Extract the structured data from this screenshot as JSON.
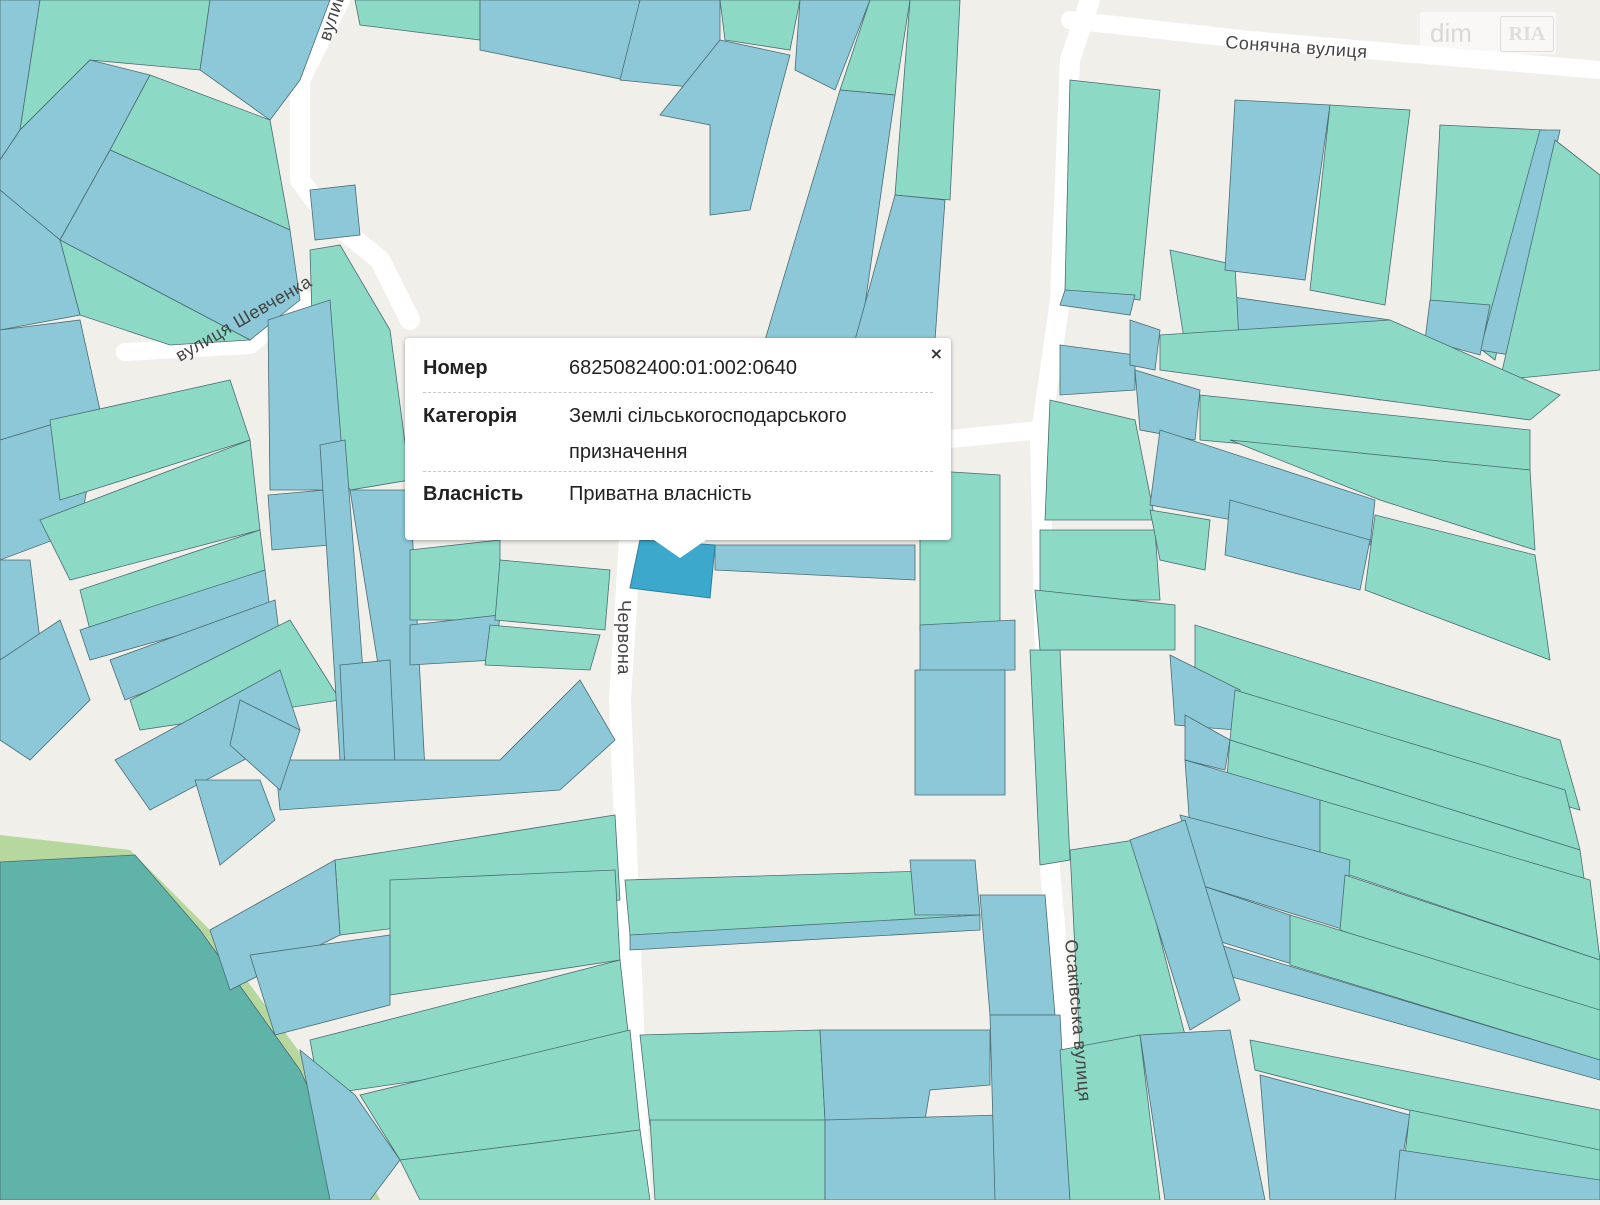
{
  "map": {
    "streets": {
      "sonyachna": "Сонячна вулиця",
      "shevchenka": "вулиця Шевченка",
      "top_left": "вулиця",
      "chervona": "Червона",
      "osakivska": "Осаківська вулиця"
    }
  },
  "popup": {
    "close_label": "×",
    "rows": [
      {
        "key": "Номер",
        "value": "6825082400:01:002:0640"
      },
      {
        "key": "Категорія",
        "value_line1": "Землі сільськогосподарського",
        "value_line2": "призначення"
      },
      {
        "key": "Власність",
        "value": "Приватна власність"
      }
    ]
  },
  "logo": {
    "left": "dim",
    "right": "RIA"
  },
  "colors": {
    "background": "#f1efea",
    "parcel_blue": "#8cc8d7",
    "parcel_green": "#8cdac6",
    "selected": "#3ba8cc",
    "forest": "#5fb3a8"
  }
}
